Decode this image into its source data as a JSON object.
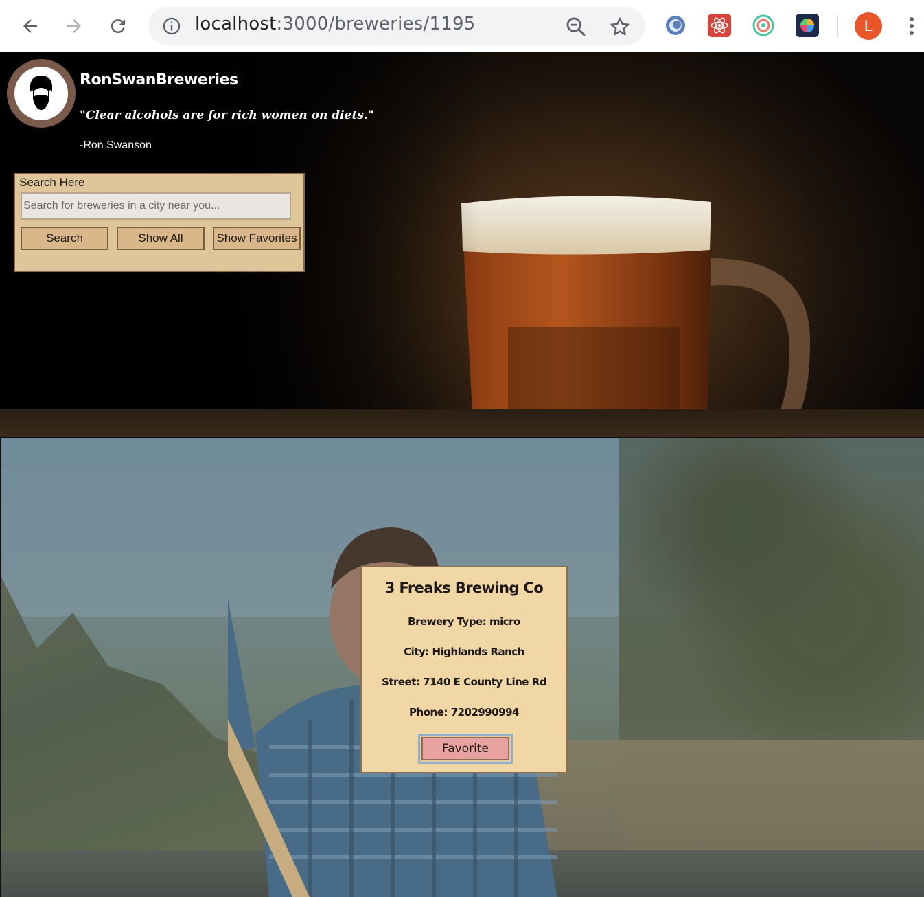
{
  "browser": {
    "url_host": "localhost",
    "url_path": ":3000/breweries/1195",
    "profile_initial": "L",
    "icons": [
      "back-arrow-icon",
      "forward-arrow-icon",
      "reload-icon",
      "info-icon",
      "zoom-out-icon",
      "star-icon",
      "menu-dots-icon"
    ],
    "extensions": [
      "ext-circle-icon",
      "ext-react-icon",
      "ext-target-icon",
      "ext-colorwheel-icon"
    ]
  },
  "header": {
    "site_title": "RonSwanBreweries",
    "quote": "\"Clear alcohols are for rich women on diets.\"",
    "author": "-Ron Swanson"
  },
  "search": {
    "label": "Search Here",
    "placeholder": "Search for breweries in a city near you...",
    "value": "",
    "search_button": "Search",
    "show_all_button": "Show All",
    "show_favorites_button": "Show Favorites"
  },
  "brewery": {
    "name": "3 Freaks Brewing Co",
    "type_line": "Brewery Type: micro",
    "city_line": "City: Highlands Ranch",
    "street_line": "Street: 7140 E County Line Rd",
    "phone_line": "Phone: 7202990994",
    "favorite_button": "Favorite"
  },
  "colors": {
    "search_panel": "#dfc59a",
    "card_bg": "#f1d7a5",
    "favorite_button": "#e8a2a2",
    "profile": "#e8562a"
  }
}
